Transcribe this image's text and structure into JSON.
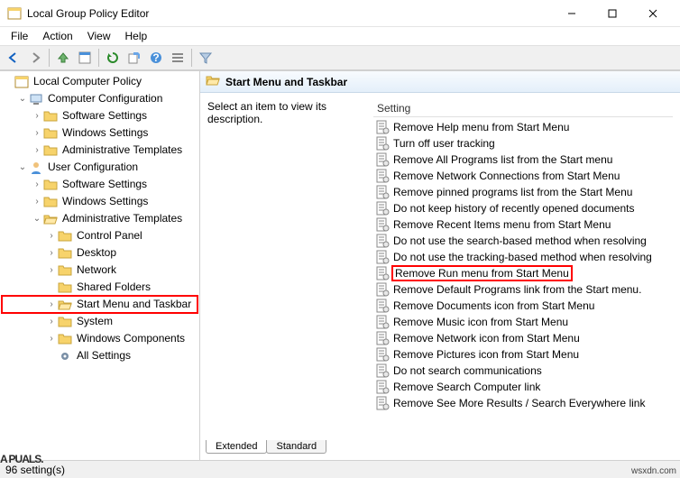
{
  "window": {
    "title": "Local Group Policy Editor"
  },
  "menubar": {
    "items": [
      "File",
      "Action",
      "View",
      "Help"
    ]
  },
  "tree": {
    "root": "Local Computer Policy",
    "computer_config": "Computer Configuration",
    "cc_software": "Software Settings",
    "cc_windows": "Windows Settings",
    "cc_admin": "Administrative Templates",
    "user_config": "User Configuration",
    "uc_software": "Software Settings",
    "uc_windows": "Windows Settings",
    "uc_admin": "Administrative Templates",
    "at_control_panel": "Control Panel",
    "at_desktop": "Desktop",
    "at_network": "Network",
    "at_shared": "Shared Folders",
    "at_startmenu": "Start Menu and Taskbar",
    "at_system": "System",
    "at_wincomp": "Windows Components",
    "at_allsettings": "All Settings"
  },
  "path_header": "Start Menu and Taskbar",
  "description": "Select an item to view its description.",
  "column_header": "Setting",
  "settings": [
    "Remove Help menu from Start Menu",
    "Turn off user tracking",
    "Remove All Programs list from the Start menu",
    "Remove Network Connections from Start Menu",
    "Remove pinned programs list from the Start Menu",
    "Do not keep history of recently opened documents",
    "Remove Recent Items menu from Start Menu",
    "Do not use the search-based method when resolving",
    "Do not use the tracking-based method when resolving",
    "Remove Run menu from Start Menu",
    "Remove Default Programs link from the Start menu.",
    "Remove Documents icon from Start Menu",
    "Remove Music icon from Start Menu",
    "Remove Network icon from Start Menu",
    "Remove Pictures icon from Start Menu",
    "Do not search communications",
    "Remove Search Computer link",
    "Remove See More Results / Search Everywhere link"
  ],
  "highlighted_setting_index": 9,
  "tabs": {
    "extended": "Extended",
    "standard": "Standard"
  },
  "status": "96 setting(s)",
  "watermark_left": "A PUALS.",
  "watermark_right": "wsxdn.com"
}
